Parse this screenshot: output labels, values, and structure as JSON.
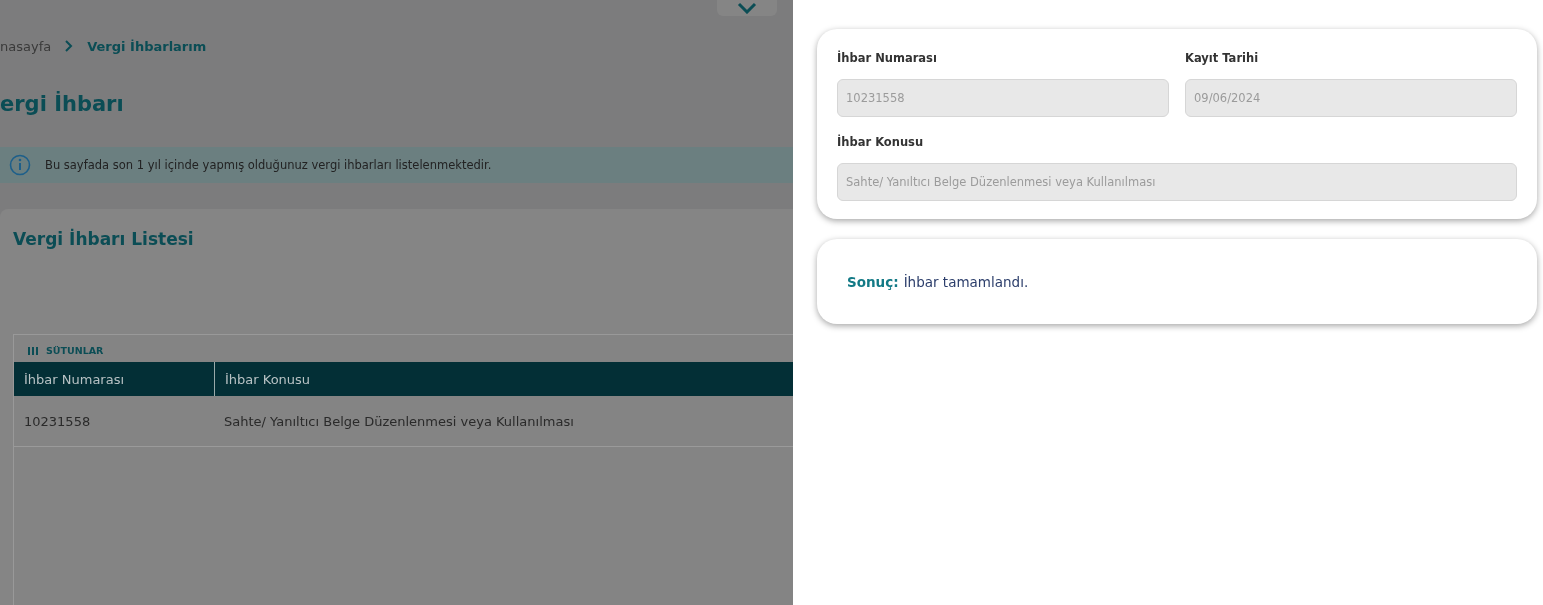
{
  "breadcrumb": [
    {
      "label": "nasayfa",
      "selected": false
    },
    {
      "label": "Vergi İhbarlarım",
      "selected": true
    }
  ],
  "page_title": "ergi İhbarı",
  "info_banner": "Bu sayfada son 1 yıl içinde yapmış olduğunuz vergi ihbarları listelenmektedir.",
  "list_card": {
    "title": "Vergi İhbarı Listesi",
    "columns_button": "SÜTUNLAR",
    "table": {
      "columns": [
        "İhbar Numarası",
        "İhbar Konusu"
      ],
      "rows": [
        [
          "10231558",
          "Sahte/ Yanıltıcı Belge Düzenlenmesi veya Kullanılması"
        ]
      ]
    }
  },
  "drawer": {
    "fields": [
      {
        "label": "İhbar Numarası",
        "value": "10231558",
        "disabled": true
      },
      {
        "label": "Kayıt Tarihi",
        "value": "09/06/2024",
        "disabled": true
      },
      {
        "label": "İhbar Konusu",
        "value": "Sahte/ Yanıltıcı Belge Düzenlenmesi veya Kullanılması",
        "disabled": true
      }
    ],
    "result": {
      "label": "Sonuç:",
      "text": "İhbar tamamlandı."
    }
  }
}
